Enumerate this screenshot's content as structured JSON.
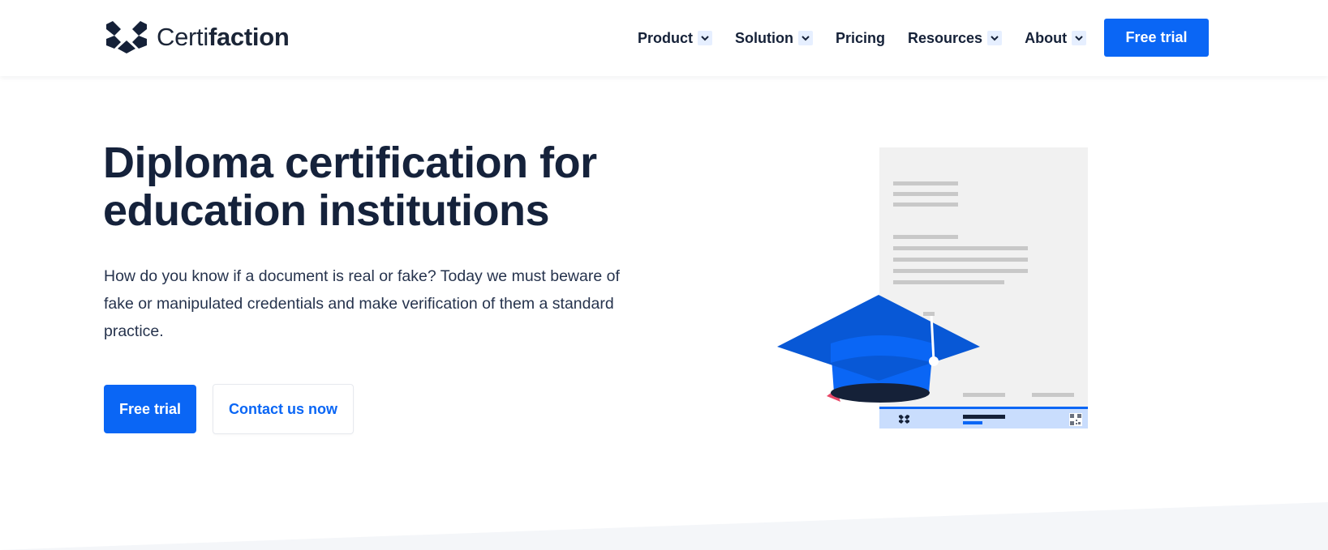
{
  "header": {
    "logo": {
      "text_light": "Certi",
      "text_bold": "faction",
      "icon": "certifaction-logo-icon"
    },
    "nav": [
      {
        "label": "Product",
        "has_dropdown": true
      },
      {
        "label": "Solution",
        "has_dropdown": true
      },
      {
        "label": "Pricing",
        "has_dropdown": false
      },
      {
        "label": "Resources",
        "has_dropdown": true
      },
      {
        "label": "About",
        "has_dropdown": true
      }
    ],
    "cta_label": "Free trial"
  },
  "hero": {
    "title_line1": "Diploma certification for",
    "title_line2": "education institutions",
    "description": "How do you know if a document is real or fake? Today we must beware of fake or manipulated credentials and make verification of them a standard practice.",
    "primary_button": "Free trial",
    "secondary_button": "Contact us now"
  },
  "illustration": {
    "subject": "diploma-with-graduation-cap",
    "icons": [
      "graduation-cap-icon",
      "certifaction-logo-icon",
      "qr-code-icon"
    ]
  },
  "colors": {
    "brand_blue": "#0a66f5",
    "navy": "#15223b",
    "light_blue": "#e6efff",
    "tassel_pink": "#e84868"
  }
}
